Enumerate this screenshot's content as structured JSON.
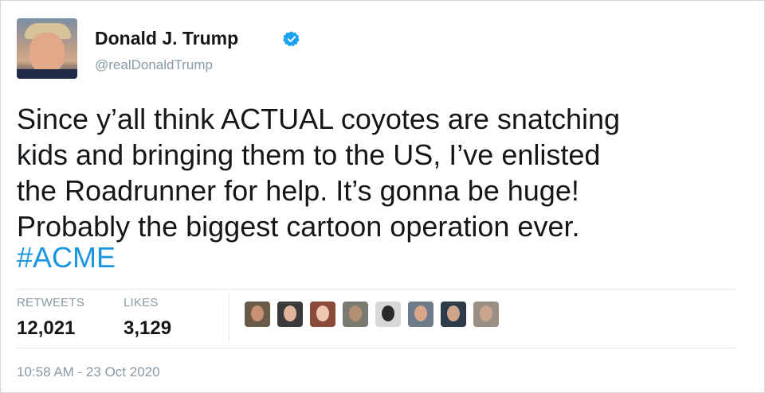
{
  "author": {
    "name": "Donald J. Trump",
    "handle": "@realDonaldTrump",
    "verified_icon": "verified-badge-icon",
    "verified_color": "#1da1f2"
  },
  "tweet": {
    "text_lines": "Since y’all think ACTUAL coyotes are snatching\nkids and bringing them to the US, I’ve enlisted\nthe Roadrunner for help. It’s gonna be huge!\nProbably the biggest cartoon operation ever.",
    "hashtag": "#ACME",
    "hashtag_color": "#1b95e0"
  },
  "stats": {
    "retweets_label": "RETWEETS",
    "retweets_value": "12,021",
    "likes_label": "LIKES",
    "likes_value": "3,129"
  },
  "likers": [
    {
      "name": "liker-avatar-1",
      "bg": "#6b5a4a",
      "skin": "#c98f73"
    },
    {
      "name": "liker-avatar-2",
      "bg": "#3a3a3a",
      "skin": "#e0b39a"
    },
    {
      "name": "liker-avatar-3",
      "bg": "#8a4b3a",
      "skin": "#f0c8b0"
    },
    {
      "name": "liker-avatar-4",
      "bg": "#7a7a70",
      "skin": "#b49072"
    },
    {
      "name": "liker-avatar-5",
      "bg": "#d8d8d8",
      "skin": "#2a2a2a"
    },
    {
      "name": "liker-avatar-6",
      "bg": "#6c7b8a",
      "skin": "#d8a78c"
    },
    {
      "name": "liker-avatar-7",
      "bg": "#2c3a4a",
      "skin": "#cfa58a"
    },
    {
      "name": "liker-avatar-8",
      "bg": "#9a8f85",
      "skin": "#c9a58e"
    }
  ],
  "timestamp": "10:58 AM - 23 Oct 2020"
}
